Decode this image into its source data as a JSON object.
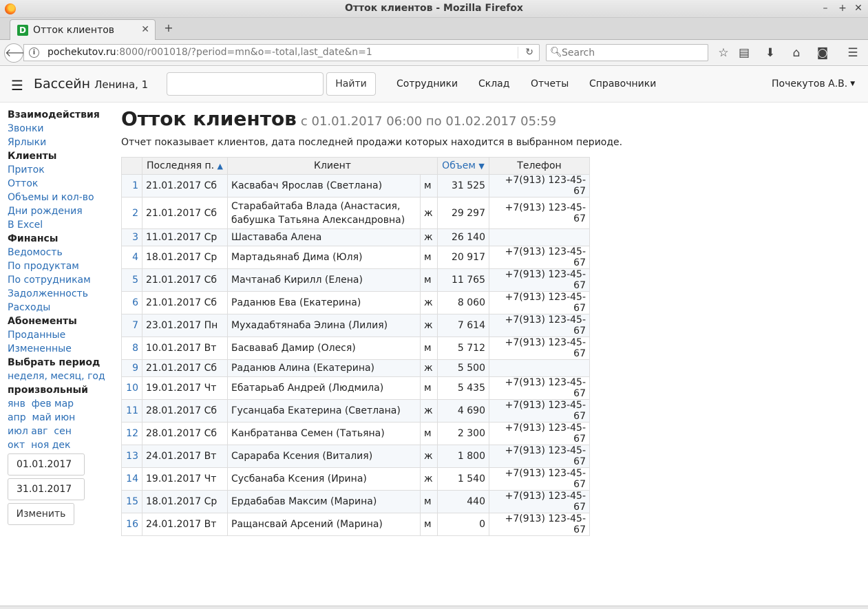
{
  "window": {
    "title": "Отток клиентов - Mozilla Firefox",
    "minimize": "–",
    "maximize": "+",
    "close": "✕"
  },
  "tab": {
    "favicon_letter": "D",
    "title": "Отток клиентов",
    "close": "✕",
    "new_tab": "+"
  },
  "navbar": {
    "url_host": "pochekutov.ru",
    "url_rest": ":8000/r001018/?period=mn&o=-total,last_date&n=1",
    "search_placeholder": "Search"
  },
  "header": {
    "brand": "Бассейн",
    "brand_sub": "Ленина, 1",
    "search_value": "",
    "find_label": "Найти",
    "nav": [
      "Сотрудники",
      "Склад",
      "Отчеты",
      "Справочники"
    ],
    "user": "Почекутов А.В."
  },
  "sidebar": {
    "interactions": {
      "title": "Взаимодействия",
      "items": [
        "Звонки",
        "Ярлыки"
      ]
    },
    "clients": {
      "title": "Клиенты",
      "items": [
        "Приток",
        "Отток",
        "Объемы и кол-во",
        "Дни рождения",
        "В Excel"
      ]
    },
    "finance": {
      "title": "Финансы",
      "items": [
        "Ведомость",
        "По продуктам",
        "По сотрудникам",
        "Задолженность",
        "Расходы"
      ]
    },
    "subscriptions": {
      "title": "Абонементы",
      "items": [
        "Проданные",
        "Измененные"
      ]
    },
    "period": {
      "title": "Выбрать период",
      "quick": [
        "неделя",
        "месяц",
        "год"
      ],
      "custom_title": "произвольный",
      "months": [
        [
          "янв",
          "фев",
          "мар"
        ],
        [
          "апр",
          "май",
          "июн"
        ],
        [
          "июл",
          "авг",
          "сен"
        ],
        [
          "окт",
          "ноя",
          "дек"
        ]
      ],
      "date_from": "01.01.2017",
      "date_to": "31.01.2017",
      "change_label": "Изменить"
    }
  },
  "main": {
    "title": "Отток клиентов",
    "period": "с 01.01.2017 06:00 по 01.02.2017 05:59",
    "description": "Отчет показывает клиентов, дата последней продажи которых находится в выбранном периоде.",
    "columns": {
      "last_date": "Последняя п.",
      "last_date_arrow": "▲",
      "client": "Клиент",
      "volume": "Объем",
      "volume_arrow": "▼",
      "phone": "Телефон"
    },
    "rows": [
      {
        "n": "1",
        "date": "21.01.2017 Сб",
        "client": "Касвабач Ярослав (Светлана)",
        "gender": "м",
        "volume": "31 525",
        "phone": "+7(913) 123-45-67"
      },
      {
        "n": "2",
        "date": "21.01.2017 Сб",
        "client": "Старабайтаба Влада (Анастасия, бабушка Татьяна Александровна)",
        "gender": "ж",
        "volume": "29 297",
        "phone": "+7(913) 123-45-67"
      },
      {
        "n": "3",
        "date": "11.01.2017 Ср",
        "client": "Шаставаба Алена",
        "gender": "ж",
        "volume": "26 140",
        "phone": ""
      },
      {
        "n": "4",
        "date": "18.01.2017 Ср",
        "client": "Мартадьянаб Дима (Юля)",
        "gender": "м",
        "volume": "20 917",
        "phone": "+7(913) 123-45-67"
      },
      {
        "n": "5",
        "date": "21.01.2017 Сб",
        "client": "Мачтанаб Кирилл (Елена)",
        "gender": "м",
        "volume": "11 765",
        "phone": "+7(913) 123-45-67"
      },
      {
        "n": "6",
        "date": "21.01.2017 Сб",
        "client": "Раданюв Ева (Екатерина)",
        "gender": "ж",
        "volume": "8 060",
        "phone": "+7(913) 123-45-67"
      },
      {
        "n": "7",
        "date": "23.01.2017 Пн",
        "client": "Мухадабтянаба Элина (Лилия)",
        "gender": "ж",
        "volume": "7 614",
        "phone": "+7(913) 123-45-67"
      },
      {
        "n": "8",
        "date": "10.01.2017 Вт",
        "client": "Басваваб Дамир (Олеся)",
        "gender": "м",
        "volume": "5 712",
        "phone": "+7(913) 123-45-67"
      },
      {
        "n": "9",
        "date": "21.01.2017 Сб",
        "client": "Раданюв Алина (Екатерина)",
        "gender": "ж",
        "volume": "5 500",
        "phone": ""
      },
      {
        "n": "10",
        "date": "19.01.2017 Чт",
        "client": "Ебатарьаб Андрей (Людмила)",
        "gender": "м",
        "volume": "5 435",
        "phone": "+7(913) 123-45-67"
      },
      {
        "n": "11",
        "date": "28.01.2017 Сб",
        "client": "Гусанцаба Екатерина (Светлана)",
        "gender": "ж",
        "volume": "4 690",
        "phone": "+7(913) 123-45-67"
      },
      {
        "n": "12",
        "date": "28.01.2017 Сб",
        "client": "Канбратанва Семен (Татьяна)",
        "gender": "м",
        "volume": "2 300",
        "phone": "+7(913) 123-45-67"
      },
      {
        "n": "13",
        "date": "24.01.2017 Вт",
        "client": "Сарараба Ксения (Виталия)",
        "gender": "ж",
        "volume": "1 800",
        "phone": "+7(913) 123-45-67"
      },
      {
        "n": "14",
        "date": "19.01.2017 Чт",
        "client": "Сусбанаба Ксения (Ирина)",
        "gender": "ж",
        "volume": "1 540",
        "phone": "+7(913) 123-45-67"
      },
      {
        "n": "15",
        "date": "18.01.2017 Ср",
        "client": "Ердабабав Максим (Марина)",
        "gender": "м",
        "volume": "440",
        "phone": "+7(913) 123-45-67"
      },
      {
        "n": "16",
        "date": "24.01.2017 Вт",
        "client": "Ращансвай Арсений (Марина)",
        "gender": "м",
        "volume": "0",
        "phone": "+7(913) 123-45-67"
      }
    ]
  },
  "colors": {
    "link": "#2a6db5",
    "favicon": "#1e9b3a"
  }
}
